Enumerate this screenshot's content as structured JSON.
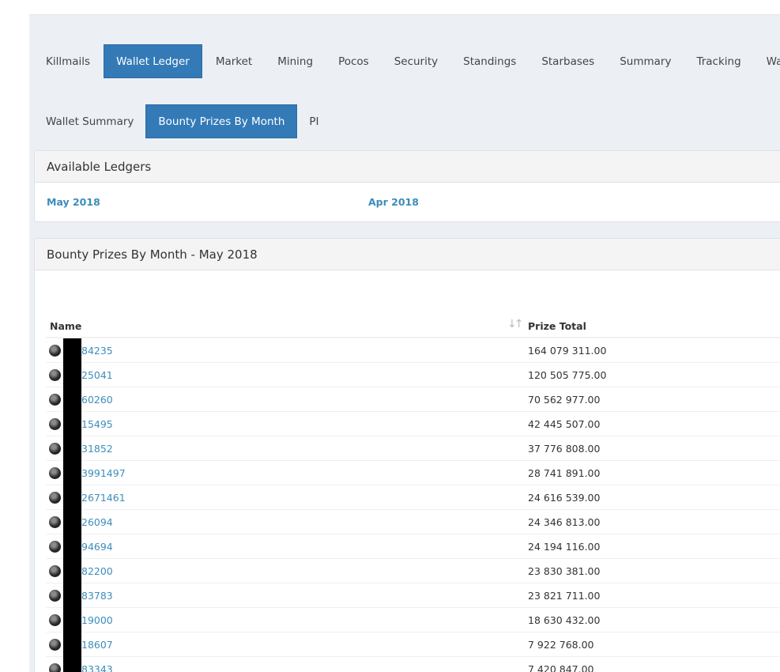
{
  "tabs_row1": [
    "Killmails",
    "Wallet Ledger",
    "Market",
    "Mining",
    "Pocos",
    "Security",
    "Standings",
    "Starbases",
    "Summary",
    "Tracking",
    "Wallet"
  ],
  "tabs_row2": [
    "Wallet Summary",
    "Bounty Prizes By Month",
    "PI"
  ],
  "available_ledgers": {
    "title": "Available Ledgers",
    "links": [
      "May 2018",
      "Apr 2018"
    ]
  },
  "bounty": {
    "title": "Bounty Prizes By Month - May 2018",
    "columns": {
      "name": "Name",
      "prize": "Prize Total"
    },
    "rows": [
      {
        "name": "84235",
        "prize": "164 079 311.00"
      },
      {
        "name": "25041",
        "prize": "120 505 775.00"
      },
      {
        "name": "60260",
        "prize": "70 562 977.00"
      },
      {
        "name": "15495",
        "prize": "42 445 507.00"
      },
      {
        "name": "31852",
        "prize": "37 776 808.00"
      },
      {
        "name": "3991497",
        "prize": "28 741 891.00"
      },
      {
        "name": "2671461",
        "prize": "24 616 539.00"
      },
      {
        "name": "26094",
        "prize": "24 346 813.00"
      },
      {
        "name": "94694",
        "prize": "24 194 116.00"
      },
      {
        "name": "82200",
        "prize": "23 830 381.00"
      },
      {
        "name": "83783",
        "prize": "23 821 711.00"
      },
      {
        "name": "19000",
        "prize": "18 630 432.00"
      },
      {
        "name": "18607",
        "prize": "7 922 768.00"
      },
      {
        "name": "83343",
        "prize": "7 420 847.00"
      }
    ]
  }
}
